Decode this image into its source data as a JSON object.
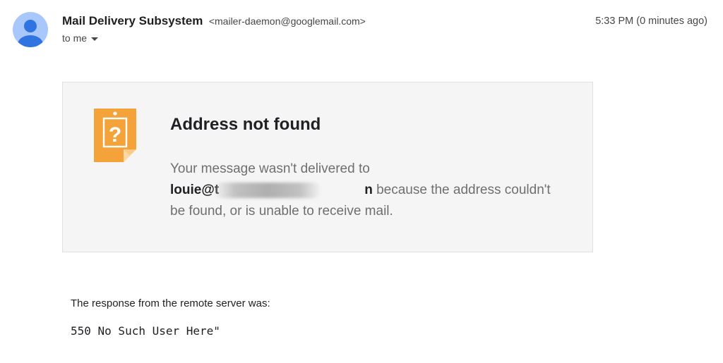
{
  "header": {
    "sender_name": "Mail Delivery Subsystem",
    "sender_email": "<mailer-daemon@googlemail.com>",
    "to_label": "to me",
    "timestamp": "5:33 PM (0 minutes ago)"
  },
  "bounce_card": {
    "icon": "question-mark-note-icon",
    "title": "Address not found",
    "body_prefix": "Your message wasn't delivered to ",
    "recipient": "louie@t",
    "recipient_tail": "n",
    "body_suffix": " because the address couldn't be found, or is unable to receive mail."
  },
  "response": {
    "label": "The response from the remote server was:",
    "code": "550 No Such User Here\""
  },
  "colors": {
    "avatar_bg": "#a8c7fa",
    "avatar_fg": "#1f6fe0",
    "card_bg": "#f5f5f5",
    "icon_orange": "#f4a33a"
  }
}
